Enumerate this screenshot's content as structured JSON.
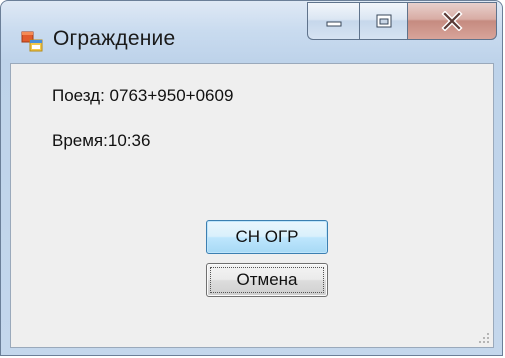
{
  "window": {
    "title": "Ограждение",
    "icon": "windows-form-icon"
  },
  "caption_buttons": {
    "minimize_icon": "minimize-icon",
    "maximize_icon": "maximize-icon",
    "close_icon": "close-icon"
  },
  "content": {
    "train_label": "Поезд: 0763+950+0609",
    "time_label": "Время:10:36"
  },
  "buttons": {
    "ok_label": "СН ОГР",
    "cancel_label": "Отмена"
  },
  "colors": {
    "client_bg": "#efefef",
    "frame": "#c4d7ec",
    "default_button_border": "#3c7fb1"
  }
}
